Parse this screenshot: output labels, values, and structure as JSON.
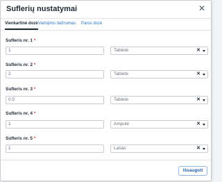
{
  "dialog": {
    "title": "Suflerių nustatymai",
    "close_icon": "close-icon"
  },
  "tabs": [
    {
      "label": "Vienkartinė dozė",
      "active": true
    },
    {
      "label": "Vartojimo dažnumas",
      "active": false
    },
    {
      "label": "Paros dozė",
      "active": false
    }
  ],
  "fields": [
    {
      "label": "Sufleris nr. 1",
      "required": "*",
      "value": "1",
      "unit": "Tabletė"
    },
    {
      "label": "Sufleris nr. 2",
      "required": "*",
      "value": "2",
      "unit": "Tabletė"
    },
    {
      "label": "Sufleris nr. 3",
      "required": "*",
      "value": "0.5",
      "unit": "Tabletė"
    },
    {
      "label": "Sufleris nr. 4",
      "required": "*",
      "value": "1",
      "unit": "Ampulė"
    },
    {
      "label": "Sufleris nr. 5",
      "required": "*",
      "value": "1",
      "unit": "Lašas"
    }
  ],
  "select_controls": {
    "clear_glyph": "✕",
    "clear_icon": "clear-icon",
    "chevron_icon": "chevron-down-icon"
  },
  "footer": {
    "save_label": "Išsaugoti"
  },
  "colors": {
    "accent": "#2a74c9",
    "required": "#d33a3a"
  }
}
